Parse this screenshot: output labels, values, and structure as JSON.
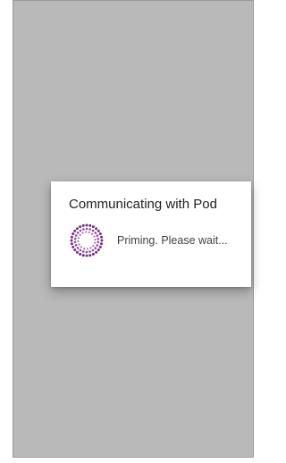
{
  "dialog": {
    "title": "Communicating with Pod",
    "message": "Priming. Please wait...",
    "spinner_icon": "dotted-circle-spinner-icon",
    "accent_color": "#7a2a8a"
  },
  "screen": {
    "background_color": "#b9b9b9"
  }
}
